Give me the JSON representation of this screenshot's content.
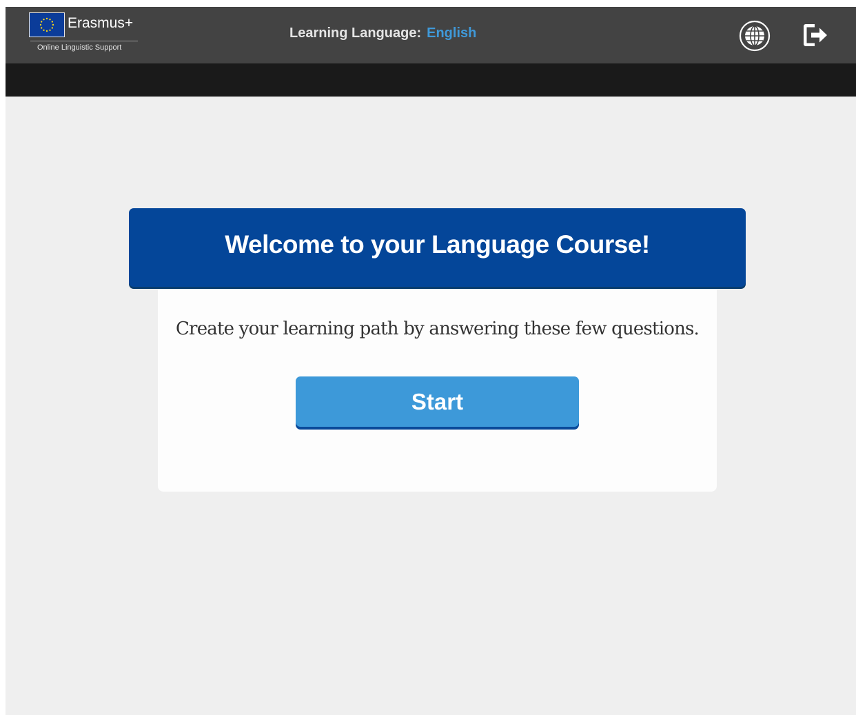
{
  "header": {
    "brand_name": "Erasmus+",
    "brand_sub": "Online Linguistic Support",
    "learning_label": "Learning Language:",
    "learning_value": "English",
    "icons": [
      "eu-flag-icon",
      "globe-icon",
      "logout-icon"
    ]
  },
  "main": {
    "title": "Welcome to your Language Course!",
    "description": "Create your learning path by answering these few questions.",
    "start_label": "Start"
  },
  "colors": {
    "topbar": "#434343",
    "subbar": "#1a1a1a",
    "background": "#efefef",
    "banner": "#044699",
    "button": "#3d99d9",
    "accent_text": "#3f99d9"
  }
}
